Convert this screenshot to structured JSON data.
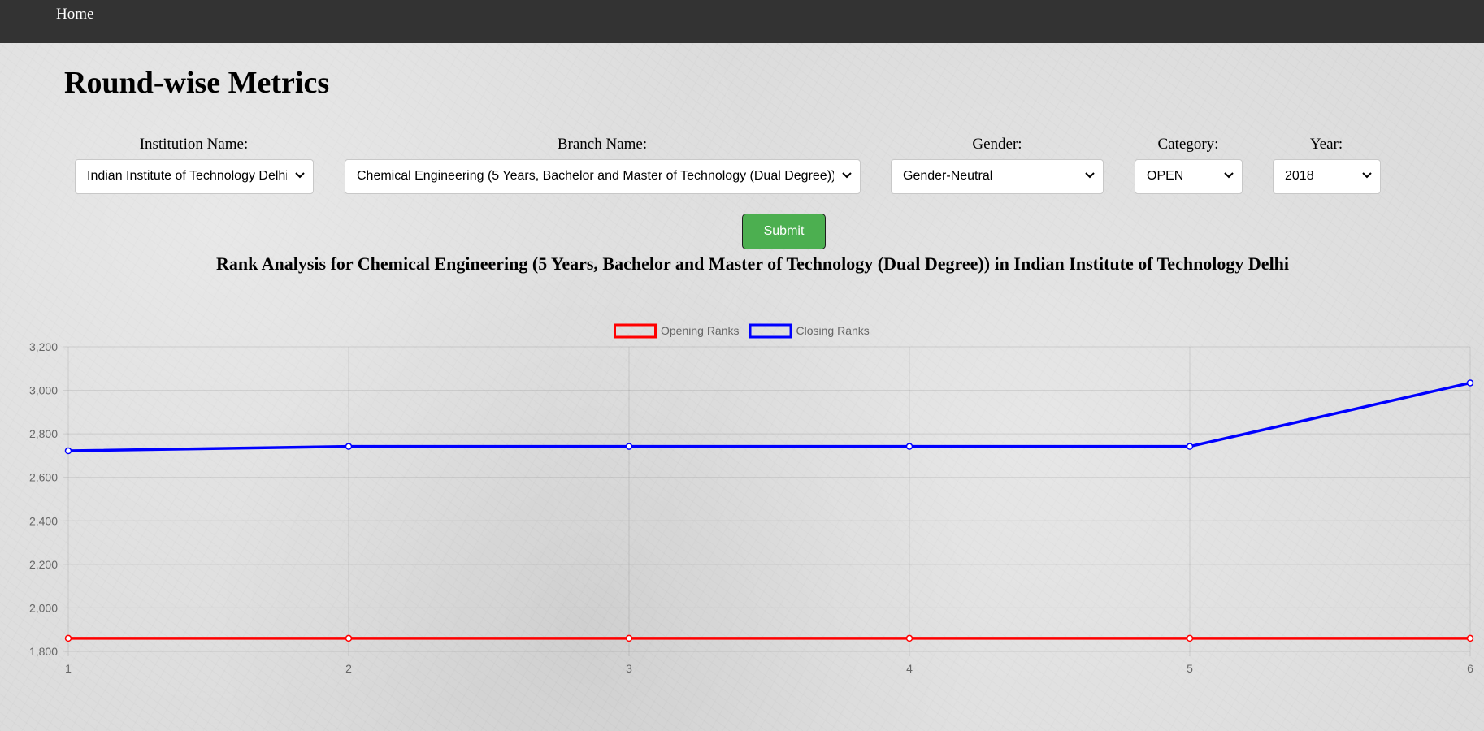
{
  "nav": {
    "home_label": "Home"
  },
  "page": {
    "title": "Round-wise Metrics"
  },
  "filters": {
    "institution": {
      "label": "Institution Name:",
      "value": "Indian Institute of Technology Delhi"
    },
    "branch": {
      "label": "Branch Name:",
      "value": "Chemical Engineering (5 Years, Bachelor and Master of Technology (Dual Degree))"
    },
    "gender": {
      "label": "Gender:",
      "value": "Gender-Neutral"
    },
    "category": {
      "label": "Category:",
      "value": "OPEN"
    },
    "year": {
      "label": "Year:",
      "value": "2018"
    }
  },
  "submit_label": "Submit",
  "icons": {
    "select_arrow": "chevron-down-icon"
  },
  "colors": {
    "navbar": "#333333",
    "submit": "#4caf50",
    "opening": "#ff0000",
    "closing": "#0000ff"
  },
  "chart_data": {
    "type": "line",
    "title": "Rank Analysis for Chemical Engineering (5 Years, Bachelor and Master of Technology (Dual Degree)) in Indian Institute of Technology Delhi",
    "x": [
      1,
      2,
      3,
      4,
      5,
      6
    ],
    "x_tick_labels": [
      "1",
      "2",
      "3",
      "4",
      "5",
      "6"
    ],
    "ylim": [
      1800,
      3200
    ],
    "y_ticks": [
      1800,
      2000,
      2200,
      2400,
      2600,
      2800,
      3000,
      3200
    ],
    "y_tick_labels": [
      "1,800",
      "2,000",
      "2,200",
      "2,400",
      "2,600",
      "2,800",
      "3,000",
      "3,200"
    ],
    "grid": true,
    "legend_position": "top-center",
    "series": [
      {
        "name": "Opening Ranks",
        "color": "#ff0000",
        "values": [
          1860,
          1860,
          1860,
          1860,
          1860,
          1860
        ]
      },
      {
        "name": "Closing Ranks",
        "color": "#0000ff",
        "values": [
          2722,
          2742,
          2742,
          2742,
          2742,
          3034
        ]
      }
    ]
  }
}
